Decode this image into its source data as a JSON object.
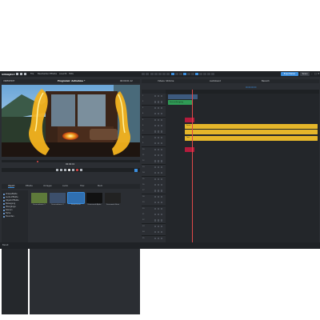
{
  "app": {
    "logo": "VPROJECT",
    "menus": [
      "File",
      "Bearbeiten",
      "Effekte",
      "Ansicht",
      "Hilfe"
    ],
    "right_buttons": [
      "Exportieren",
      "Teilen"
    ],
    "window_controls": [
      "–",
      "□",
      "✕"
    ]
  },
  "left_header": {
    "title": "VIDEOEDIT",
    "project": "Programm: Aufnahme *",
    "timecode": "00:00:01:12"
  },
  "timeline_header": {
    "left": "Videos: Stimme",
    "mid": "Audioband",
    "right": "Bereich",
    "value": "00:00:00:00"
  },
  "transport": {
    "timecode": "00:00:01"
  },
  "tabs": [
    "Import",
    "Effekte",
    "Vorlagen",
    "Audio",
    "Titel",
    "Mehr"
  ],
  "media_list": [
    "Videoeffekte",
    "Audio-Effekte",
    "Objekt-Effekte",
    "Bewegung",
    "Übergänge",
    "Szenen",
    "Farbe",
    "Favoriten"
  ],
  "thumbnails": [
    {
      "caption": "Feuerrahmen 1",
      "color": "#5e7a3a"
    },
    {
      "caption": "Feuerrahmen 2",
      "color": "#3c4f6b"
    },
    {
      "caption": "Portal Feuer",
      "color": "#2f6fb1",
      "selected": true
    },
    {
      "caption": "Feuerwerk Alpha",
      "color": "#111111"
    },
    {
      "caption": "Feuerwerk Beta",
      "color": "#222222"
    }
  ],
  "tracks": [
    "1",
    "2",
    "3",
    "4",
    "5",
    "6",
    "7",
    "8",
    "9",
    "10",
    "11",
    "12",
    "13",
    "14",
    "15",
    "16",
    "17",
    "18",
    "19",
    "20",
    "21",
    "22",
    "23",
    "24",
    "25",
    "26"
  ],
  "clips": [
    {
      "track": 1,
      "color": "#3d5a7e",
      "label": ""
    },
    {
      "track": 2,
      "color": "#2f9a55",
      "label": "Szenenübergang"
    },
    {
      "track": 5,
      "color": "#b41b3c",
      "label": ""
    },
    {
      "track": 6,
      "color": "#e5b62a",
      "label": "Feuer"
    },
    {
      "track": 7,
      "color": "#e5b62a",
      "label": ""
    },
    {
      "track": 8,
      "color": "#e5b62a",
      "label": "Text"
    },
    {
      "track": 10,
      "color": "#b41b3c",
      "label": ""
    }
  ],
  "status": {
    "text": "Bereit"
  }
}
